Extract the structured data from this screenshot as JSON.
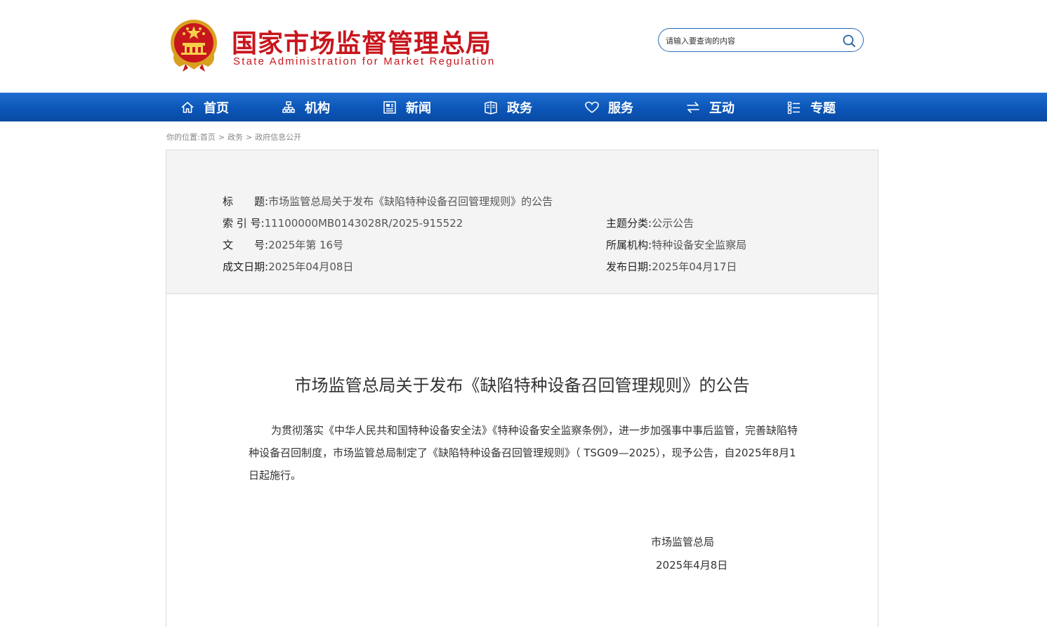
{
  "header": {
    "title": "国家市场监督管理总局",
    "subtitle": "State Administration for Market Regulation",
    "search_placeholder": "请输入要查询的内容"
  },
  "nav": {
    "items": [
      {
        "label": "首页",
        "icon": "home-icon"
      },
      {
        "label": "机构",
        "icon": "org-chart-icon"
      },
      {
        "label": "新闻",
        "icon": "newspaper-icon"
      },
      {
        "label": "政务",
        "icon": "book-icon"
      },
      {
        "label": "服务",
        "icon": "heart-icon"
      },
      {
        "label": "互动",
        "icon": "exchange-arrows-icon"
      },
      {
        "label": "专题",
        "icon": "list-icon"
      }
    ]
  },
  "breadcrumb": {
    "prefix": "你的位置:",
    "items": [
      "首页",
      "政务",
      "政府信息公开"
    ],
    "separator": ">"
  },
  "meta": {
    "title_label": "标　　题:",
    "title_value": "市场监管总局关于发布《缺陷特种设备召回管理规则》的公告",
    "index_label": "索 引 号:",
    "index_value": "11100000MB0143028R/2025-915522",
    "category_label": "主题分类:",
    "category_value": "公示公告",
    "doc_no_label": "文　　号:",
    "doc_no_value": "2025年第 16号",
    "dept_label": "所属机构:",
    "dept_value": "特种设备安全监察局",
    "written_label": "成文日期:",
    "written_value": "2025年04月08日",
    "published_label": "发布日期:",
    "published_value": "2025年04月17日"
  },
  "article": {
    "title": "市场监管总局关于发布《缺陷特种设备召回管理规则》的公告",
    "body": "为贯彻落实《中华人民共和国特种设备安全法》《特种设备安全监察条例》，进一步加强事中事后监管，完善缺陷特种设备召回制度，市场监管总局制定了《缺陷特种设备召回管理规则》（ TSG09—2025），现予公告，自2025年8月1日起施行。",
    "signature_org": "市场监管总局",
    "signature_date": "2025年4月8日"
  },
  "colors": {
    "brand_red": "#c8161d",
    "nav_blue": "#0b56b8",
    "search_border": "#2a6bb5",
    "meta_bg": "#f4f4f4"
  }
}
